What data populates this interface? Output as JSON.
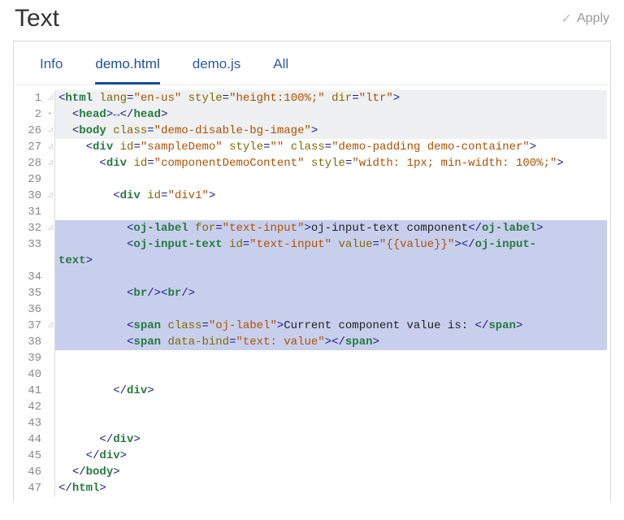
{
  "header": {
    "title": "Text",
    "apply_label": "Apply"
  },
  "tabs": [
    {
      "label": "Info"
    },
    {
      "label": "demo.html"
    },
    {
      "label": "demo.js"
    },
    {
      "label": "All"
    }
  ],
  "active_tab_index": 1,
  "gutter": [
    {
      "num": "1",
      "fold": "◿"
    },
    {
      "num": "2",
      "fold": "▸"
    },
    {
      "num": "26",
      "fold": "◿"
    },
    {
      "num": "27",
      "fold": "◿"
    },
    {
      "num": "28",
      "fold": "◿"
    },
    {
      "num": "29",
      "fold": ""
    },
    {
      "num": "30",
      "fold": "◿"
    },
    {
      "num": "31",
      "fold": ""
    },
    {
      "num": "32",
      "fold": "◿"
    },
    {
      "num": "33",
      "fold": ""
    },
    {
      "num": "",
      "fold": ""
    },
    {
      "num": "34",
      "fold": ""
    },
    {
      "num": "35",
      "fold": ""
    },
    {
      "num": "36",
      "fold": ""
    },
    {
      "num": "37",
      "fold": "◿"
    },
    {
      "num": "38",
      "fold": ""
    },
    {
      "num": "39",
      "fold": ""
    },
    {
      "num": "40",
      "fold": ""
    },
    {
      "num": "41",
      "fold": ""
    },
    {
      "num": "42",
      "fold": ""
    },
    {
      "num": "43",
      "fold": ""
    },
    {
      "num": "44",
      "fold": ""
    },
    {
      "num": "45",
      "fold": ""
    },
    {
      "num": "46",
      "fold": ""
    },
    {
      "num": "47",
      "fold": ""
    }
  ],
  "code_lines": [
    {
      "hl": "fold",
      "html": "<span class='pun'>&lt;</span><span class='tag'>html</span> <span class='attr'>lang</span><span class='pun'>=</span><span class='str'>\"en-us\"</span> <span class='attr'>style</span><span class='pun'>=</span><span class='str'>\"height:100%;\"</span> <span class='attr'>dir</span><span class='pun'>=</span><span class='str'>\"ltr\"</span><span class='pun'>&gt;</span>"
    },
    {
      "hl": "fold",
      "html": "  <span class='pun'>&lt;</span><span class='tag'>head</span><span class='pun'>&gt;</span><span class='collapse-marker'>&#8596;</span><span class='pun'>&lt;/</span><span class='tag'>head</span><span class='pun'>&gt;</span>"
    },
    {
      "hl": "fold",
      "html": "  <span class='pun'>&lt;</span><span class='tag'>body</span> <span class='attr'>class</span><span class='pun'>=</span><span class='str'>\"demo-disable-bg-image\"</span><span class='pun'>&gt;</span>"
    },
    {
      "hl": "",
      "html": "    <span class='pun'>&lt;</span><span class='tag'>div</span> <span class='attr'>id</span><span class='pun'>=</span><span class='str'>\"sampleDemo\"</span> <span class='attr'>style</span><span class='pun'>=</span><span class='str'>\"\"</span> <span class='attr'>class</span><span class='pun'>=</span><span class='str'>\"demo-padding demo-container\"</span><span class='pun'>&gt;</span>"
    },
    {
      "hl": "",
      "html": "      <span class='pun'>&lt;</span><span class='tag'>div</span> <span class='attr'>id</span><span class='pun'>=</span><span class='str'>\"componentDemoContent\"</span> <span class='attr'>style</span><span class='pun'>=</span><span class='str'>\"width: 1px; min-width: 100%;\"</span><span class='pun'>&gt;</span>"
    },
    {
      "hl": "",
      "html": ""
    },
    {
      "hl": "",
      "html": "        <span class='pun'>&lt;</span><span class='tag'>div</span> <span class='attr'>id</span><span class='pun'>=</span><span class='str'>\"div1\"</span><span class='pun'>&gt;</span>"
    },
    {
      "hl": "",
      "html": ""
    },
    {
      "hl": "sel",
      "html": "          <span class='pun'>&lt;</span><span class='tag'>oj-label</span> <span class='attr'>for</span><span class='pun'>=</span><span class='str'>\"text-input\"</span><span class='pun'>&gt;</span><span class='txt'>oj-input-text component</span><span class='pun'>&lt;/</span><span class='tag'>oj-label</span><span class='pun'>&gt;</span>"
    },
    {
      "hl": "sel",
      "html": "          <span class='pun'>&lt;</span><span class='tag'>oj-input-text</span> <span class='attr'>id</span><span class='pun'>=</span><span class='str'>\"text-input\"</span> <span class='attr'>value</span><span class='pun'>=</span><span class='str'>\"{{value}}\"</span><span class='pun'>&gt;&lt;/</span><span class='tag'>oj-input-"
    },
    {
      "hl": "sel",
      "html": "<span class='tag'>text</span><span class='pun'>&gt;</span>"
    },
    {
      "hl": "sel",
      "html": ""
    },
    {
      "hl": "sel",
      "html": "          <span class='pun'>&lt;</span><span class='tag'>br</span><span class='pun'>/&gt;&lt;</span><span class='tag'>br</span><span class='pun'>/&gt;</span>"
    },
    {
      "hl": "sel",
      "html": ""
    },
    {
      "hl": "sel",
      "html": "          <span class='pun'>&lt;</span><span class='tag'>span</span> <span class='attr'>class</span><span class='pun'>=</span><span class='str'>\"oj-label\"</span><span class='pun'>&gt;</span><span class='txt'>Current component value is: </span><span class='pun'>&lt;/</span><span class='tag'>span</span><span class='pun'>&gt;</span>"
    },
    {
      "hl": "sel",
      "html": "          <span class='pun'>&lt;</span><span class='tag'>span</span> <span class='attr'>data-bind</span><span class='pun'>=</span><span class='str'>\"text: value\"</span><span class='pun'>&gt;&lt;/</span><span class='tag'>span</span><span class='pun'>&gt;</span>"
    },
    {
      "hl": "",
      "html": ""
    },
    {
      "hl": "",
      "html": ""
    },
    {
      "hl": "",
      "html": "        <span class='pun'>&lt;/</span><span class='tag'>div</span><span class='pun'>&gt;</span>"
    },
    {
      "hl": "",
      "html": ""
    },
    {
      "hl": "",
      "html": ""
    },
    {
      "hl": "",
      "html": "      <span class='pun'>&lt;/</span><span class='tag'>div</span><span class='pun'>&gt;</span>"
    },
    {
      "hl": "",
      "html": "    <span class='pun'>&lt;/</span><span class='tag'>div</span><span class='pun'>&gt;</span>"
    },
    {
      "hl": "",
      "html": "  <span class='pun'>&lt;/</span><span class='tag'>body</span><span class='pun'>&gt;</span>"
    },
    {
      "hl": "",
      "html": "<span class='pun'>&lt;/</span><span class='tag'>html</span><span class='pun'>&gt;</span>"
    }
  ]
}
